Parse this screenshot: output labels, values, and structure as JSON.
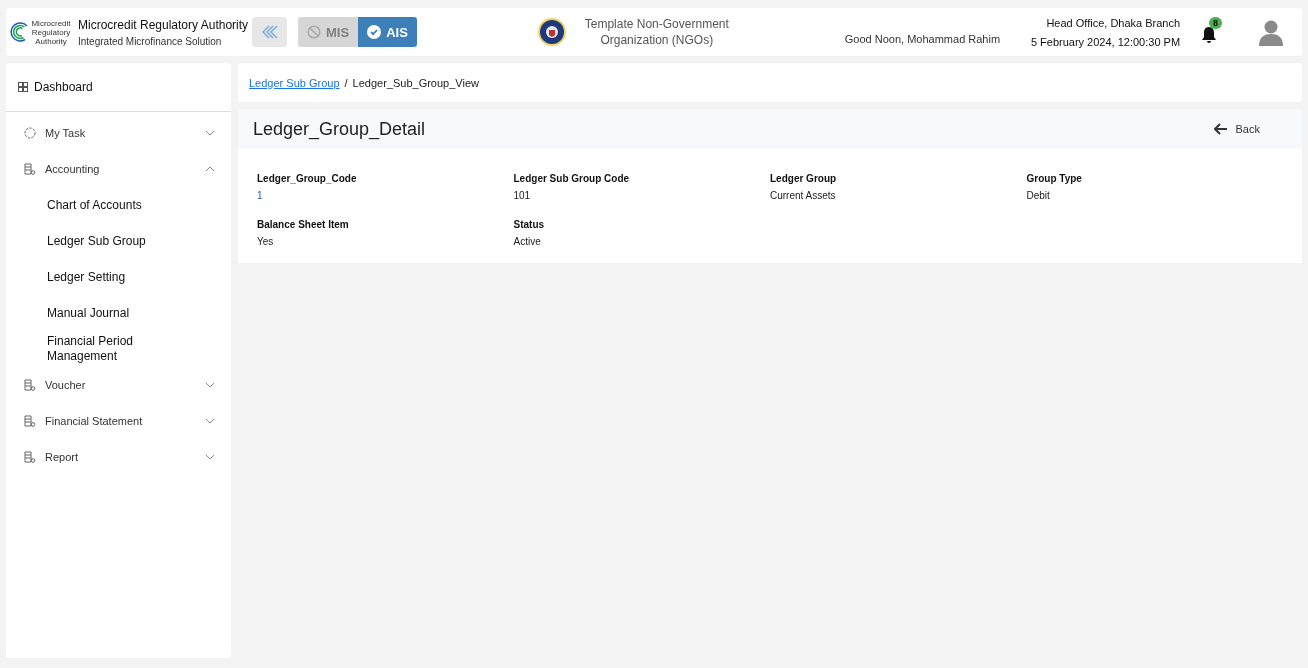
{
  "header": {
    "logo_text": "Microcredit Regulatory Authority",
    "title": "Microcredit Regulatory Authority",
    "subtitle": "Integrated Microfinance Solution",
    "modes": [
      {
        "label": "MIS",
        "selected": false
      },
      {
        "label": "AIS",
        "selected": true
      }
    ],
    "organization": "Template Non-Government Organization (NGOs)",
    "greeting": "Good Noon, Mohammad Rahim",
    "branch": "Head Office, Dhaka Branch",
    "datetime": "5 February 2024, 12:00:30 PM",
    "notification_count": "8"
  },
  "sidebar": {
    "dashboard": "Dashboard",
    "items": [
      {
        "label": "My Task",
        "kind": "task",
        "expanded": false
      },
      {
        "label": "Accounting",
        "kind": "doc",
        "expanded": true,
        "children": [
          {
            "label": "Chart of Accounts"
          },
          {
            "label": "Ledger Sub Group"
          },
          {
            "label": "Ledger Setting"
          },
          {
            "label": "Manual Journal"
          },
          {
            "label": "Financial Period Management"
          }
        ]
      },
      {
        "label": "Voucher",
        "kind": "doc",
        "expanded": false
      },
      {
        "label": "Financial Statement",
        "kind": "doc",
        "expanded": false
      },
      {
        "label": "Report",
        "kind": "doc",
        "expanded": false
      }
    ]
  },
  "breadcrumb": [
    {
      "label": "Ledger Sub Group",
      "kind": "link"
    },
    {
      "label": "/",
      "kind": "separator"
    },
    {
      "label": "Ledger_Sub_Group_View",
      "kind": "text"
    }
  ],
  "detail": {
    "title": "Ledger_Group_Detail",
    "back": "Back",
    "fields": [
      {
        "label": "Ledger_Group_Code",
        "value": "1",
        "kind": "link"
      },
      {
        "label": "Ledger Sub Group Code",
        "value": "101",
        "kind": "text"
      },
      {
        "label": "Ledger Group",
        "value": "Current Assets",
        "kind": "text"
      },
      {
        "label": "Group Type",
        "value": "Debit",
        "kind": "text"
      },
      {
        "label": "Balance Sheet Item",
        "value": "Yes",
        "kind": "text"
      },
      {
        "label": "Status",
        "value": "Active",
        "kind": "text"
      }
    ]
  }
}
